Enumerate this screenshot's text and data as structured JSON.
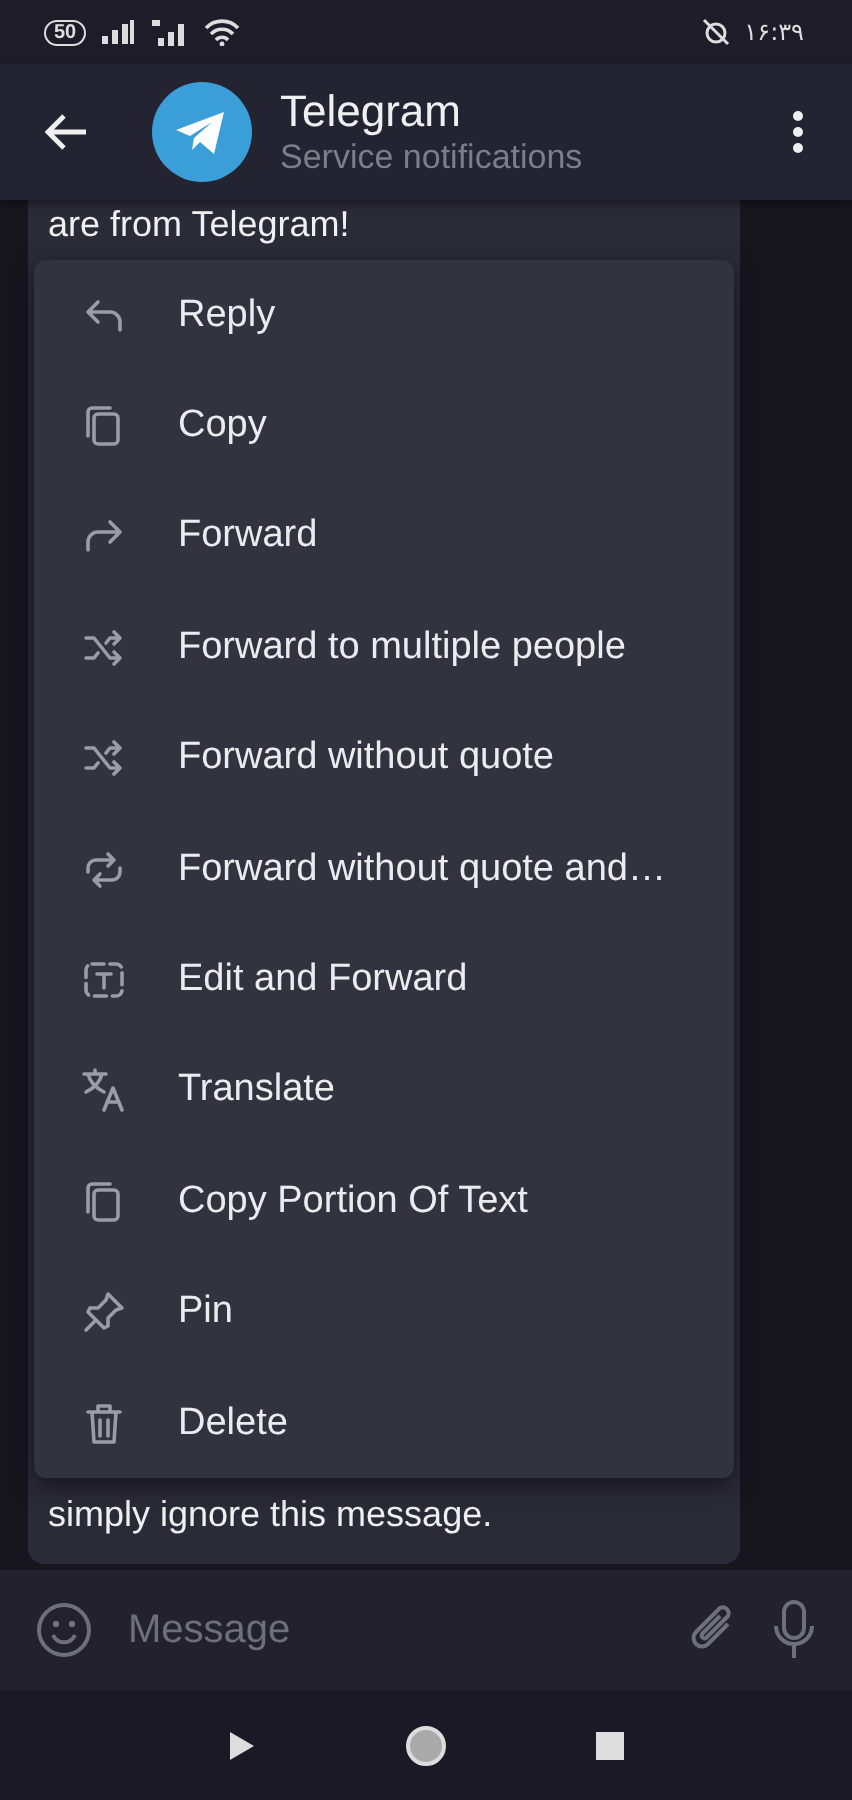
{
  "status_bar": {
    "battery": "50",
    "time": "۱۶:۳۹"
  },
  "header": {
    "title": "Telegram",
    "subtitle": "Service notifications"
  },
  "message": {
    "lines": [
      "are from Telegram!",
      "simply ignore this message."
    ]
  },
  "context_menu": {
    "items": [
      {
        "label": "Reply"
      },
      {
        "label": "Copy"
      },
      {
        "label": "Forward"
      },
      {
        "label": "Forward to multiple people"
      },
      {
        "label": "Forward without quote"
      },
      {
        "label": "Forward without quote and…"
      },
      {
        "label": "Edit and Forward"
      },
      {
        "label": "Translate"
      },
      {
        "label": "Copy Portion Of Text"
      },
      {
        "label": "Pin"
      },
      {
        "label": "Delete"
      }
    ]
  },
  "composer": {
    "placeholder": "Message"
  }
}
